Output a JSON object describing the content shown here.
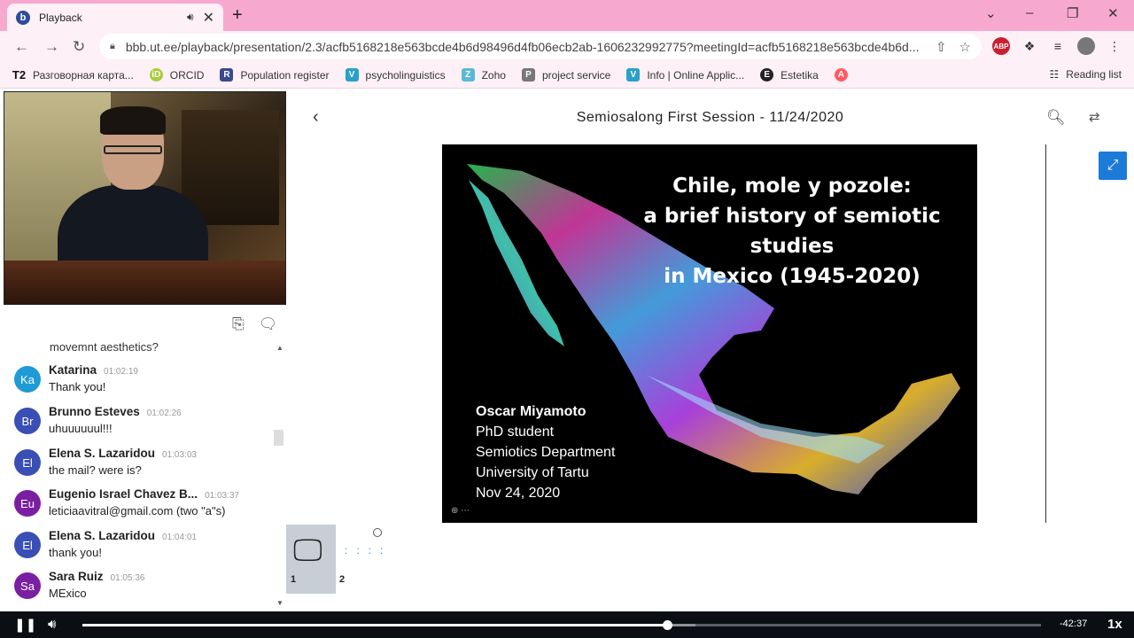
{
  "browser": {
    "tab": {
      "title": "Playback",
      "favicon": "b",
      "audio_icon": "speaker-icon",
      "close_icon": "close-icon"
    },
    "new_tab_icon": "plus-icon",
    "window_controls": [
      "chevron-down-icon",
      "minimize-icon",
      "restore-icon",
      "close-icon"
    ],
    "url": "bbb.ut.ee/playback/presentation/2.3/acfb5168218e563bcde4b6d98496d4fb06ecb2ab-1606232992775?meetingId=acfb5168218e563bcde4b6d...",
    "bookmarks": [
      {
        "label": "Разговорная карта...",
        "icon": "T2",
        "color": "#111111"
      },
      {
        "label": "ORCID",
        "icon": "iD",
        "color": "#a6ce39"
      },
      {
        "label": "Population register",
        "icon": "R",
        "color": "#3a4a8c"
      },
      {
        "label": "psycholinguistics",
        "icon": "V",
        "color": "#2aa0c8"
      },
      {
        "label": "Zoho",
        "icon": "Z",
        "color": "#5bb8d6"
      },
      {
        "label": "project service",
        "icon": "P",
        "color": "#777777"
      },
      {
        "label": "Info | Online Applic...",
        "icon": "V",
        "color": "#2aa0c8"
      },
      {
        "label": "Estetika",
        "icon": "E",
        "color": "#222222"
      },
      {
        "label": "",
        "icon": "A",
        "color": "#ff5a5f"
      }
    ],
    "reading_list": "Reading list"
  },
  "presentation": {
    "title": "Semiosalong First Session - 11/24/2020",
    "slide": {
      "title_lines": [
        "Chile, mole y pozole:",
        "a brief history of semiotic studies",
        "in Mexico (1945-2020)"
      ],
      "author_lines": [
        "Oscar Miyamoto",
        "PhD student",
        "Semiotics Department",
        "University of Tartu",
        "Nov 24, 2020"
      ]
    },
    "thumbnails": [
      {
        "number": "1",
        "icon": "monitor-icon"
      },
      {
        "number": "2",
        "icon": "slide-thumbnail"
      }
    ]
  },
  "chat": {
    "top_partial": "movemnt aesthetics?",
    "messages": [
      {
        "initials": "Ka",
        "color": "#1e9bd7",
        "name": "Katarina",
        "time": "01:02:19",
        "text": "Thank you!"
      },
      {
        "initials": "Br",
        "color": "#3a4fb5",
        "name": "Brunno Esteves",
        "time": "01:02:26",
        "text": "uhuuuuuul!!!"
      },
      {
        "initials": "El",
        "color": "#3a4fb5",
        "name": "Elena S. Lazaridou",
        "time": "01:03:03",
        "text": "the mail? were is?"
      },
      {
        "initials": "Eu",
        "color": "#7a1fa2",
        "name": "Eugenio Israel Chavez B...",
        "time": "01:03:37",
        "text": "leticiaavitral@gmail.com (two \"a\"s)"
      },
      {
        "initials": "El",
        "color": "#3a4fb5",
        "name": "Elena S. Lazaridou",
        "time": "01:04:01",
        "text": "thank you!"
      },
      {
        "initials": "Sa",
        "color": "#7a1fa2",
        "name": "Sara Ruiz",
        "time": "01:05:36",
        "text": "MExico"
      }
    ]
  },
  "player": {
    "remaining": "-42:37",
    "speed": "1x",
    "progress_fraction": 0.61,
    "buffered_fraction": 0.64
  }
}
